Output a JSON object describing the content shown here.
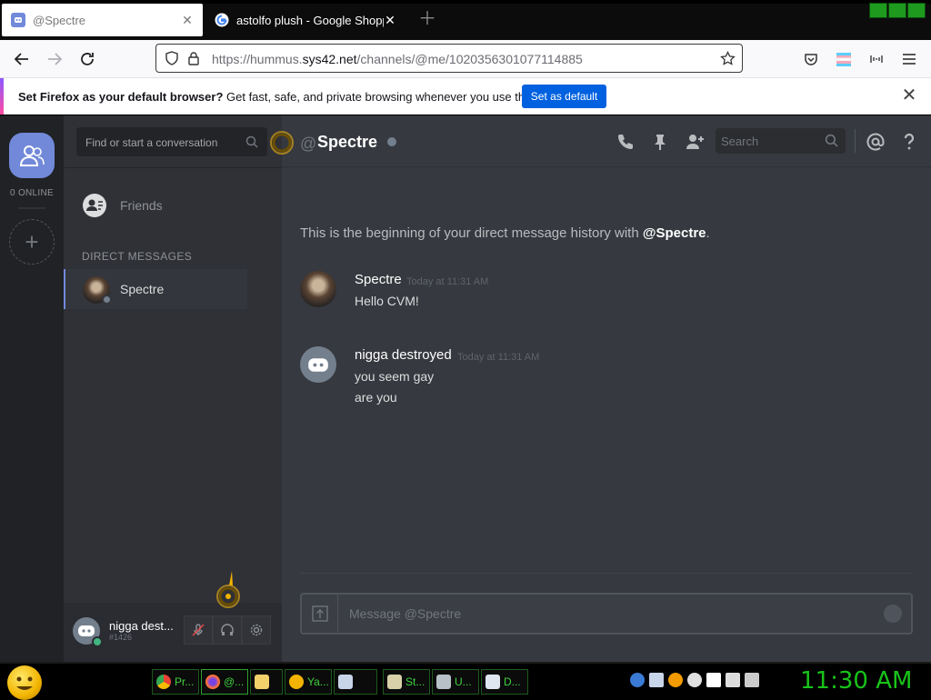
{
  "browser": {
    "tabs": [
      {
        "title": "@Spectre",
        "active": true
      },
      {
        "title": "astolfo plush - Google Shopping",
        "active": false
      }
    ],
    "url_prefix": "https://hummus.",
    "url_domain": "sys42.net",
    "url_path": "/channels/@me/1020356301077114885",
    "notification": {
      "bold": "Set Firefox as your default browser?",
      "text": " Get fast, safe, and private browsing whenever you use the web.",
      "button": "Set as default"
    }
  },
  "discord": {
    "online_count": "0 ONLINE",
    "dm_search_placeholder": "Find or start a conversation",
    "friends_label": "Friends",
    "dm_header": "DIRECT MESSAGES",
    "dm_item": "Spectre",
    "user": {
      "name": "nigga destroyed",
      "name_display": "nigga dest...",
      "tag": "#1426"
    },
    "chat": {
      "at": "@",
      "recipient": "Spectre",
      "search_placeholder": "Search",
      "intro": "This is the beginning of your direct message history with ",
      "intro_mention": "@Spectre",
      "intro_end": ".",
      "composer_placeholder": "Message @Spectre",
      "messages": [
        {
          "author": "Spectre",
          "time": "Today at 11:31 AM",
          "lines": [
            "Hello CVM!"
          ]
        },
        {
          "author": "nigga destroyed",
          "time": "Today at 11:31 AM",
          "lines": [
            "you seem gay",
            "are you"
          ]
        }
      ]
    }
  },
  "taskbar": {
    "buttons": [
      "Pr...",
      "@...",
      "",
      "Ya...",
      "",
      "St...",
      "U...",
      "D..."
    ],
    "clock": "11:30 AM"
  },
  "colors": {
    "blurple": "#7289da",
    "online_green": "#43b581",
    "firefox_blue": "#0061e0",
    "clock_green": "#19c319"
  }
}
